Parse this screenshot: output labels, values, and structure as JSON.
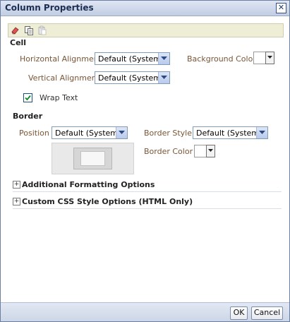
{
  "dialog": {
    "title": "Column Properties",
    "close_icon": "close-x-icon"
  },
  "toolbar": {
    "icons": [
      "eraser-icon",
      "copy-icon",
      "paste-icon"
    ]
  },
  "cell": {
    "section_title": "Cell",
    "horizontal_alignment": {
      "label": "Horizontal Alignment",
      "value": "Default (System)"
    },
    "vertical_alignment": {
      "label": "Vertical Alignment",
      "value": "Default (System)"
    },
    "background_color": {
      "label": "Background Color",
      "value": "#ffffff"
    },
    "wrap_text": {
      "label": "Wrap Text",
      "checked": true
    }
  },
  "border": {
    "section_title": "Border",
    "position": {
      "label": "Position",
      "value": "Default (System)"
    },
    "border_style": {
      "label": "Border Style",
      "value": "Default (System)"
    },
    "border_color": {
      "label": "Border Color",
      "value": "#ffffff"
    }
  },
  "expanders": {
    "additional": {
      "label": "Additional Formatting Options",
      "expanded": false
    },
    "custom_css": {
      "label": "Custom CSS Style Options (HTML Only)",
      "expanded": false
    }
  },
  "footer": {
    "ok_label": "OK",
    "cancel_label": "Cancel"
  },
  "colors": {
    "checkbox_check": "#0b8a2a",
    "label_text": "#7a5535",
    "toolbar_bg": "#eeedd6"
  }
}
